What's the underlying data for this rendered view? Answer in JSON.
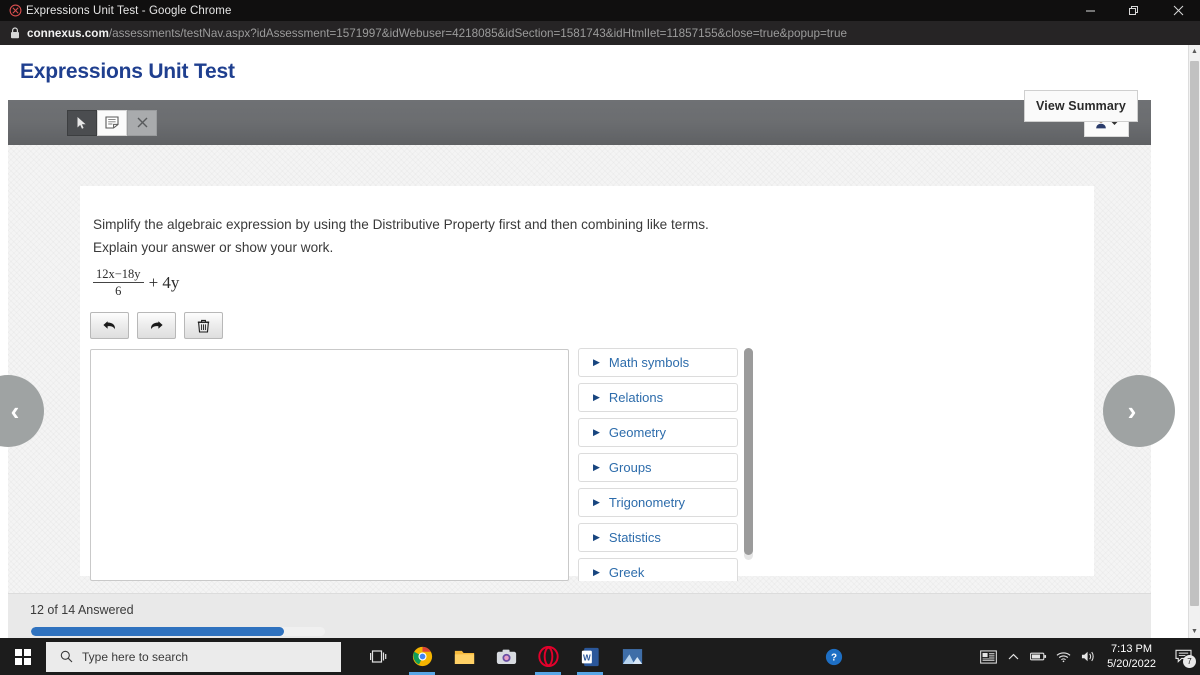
{
  "browser": {
    "window_title": "Expressions Unit Test - Google Chrome",
    "app_icon": "chrome-icon",
    "minimize_label": "–",
    "restore_label": "❐",
    "close_label": "✕",
    "url_host": "connexus.com",
    "url_path": "/assessments/testNav.aspx?idAssessment=1571997&idWebuser=4218085&idSection=1581743&idHtmlIet=11857155&close=true&popup=true",
    "lock_icon": "lock-icon"
  },
  "page": {
    "title": "Expressions Unit Test"
  },
  "toolbar": {
    "buttons": [
      {
        "name": "pointer-tool",
        "icon": "cursor-arrow-icon",
        "state": "selected"
      },
      {
        "name": "annotate-tool",
        "icon": "note-icon",
        "state": "normal"
      },
      {
        "name": "clear-tool",
        "icon": "close-x-icon",
        "state": "disabled"
      }
    ],
    "user_menu": {
      "icon": "user-icon",
      "caret": "▼"
    }
  },
  "question": {
    "prompt_line1": "Simplify the algebraic expression by using the Distributive Property first and then combining like terms.",
    "prompt_line2": "Explain your answer or show your work.",
    "expression": {
      "numerator": "12x−18y",
      "denominator": "6",
      "trailing": "+ 4y"
    },
    "edit_buttons": [
      {
        "name": "undo-button",
        "icon": "undo-arrow-icon",
        "label": "↶"
      },
      {
        "name": "redo-button",
        "icon": "redo-arrow-icon",
        "label": "↷"
      },
      {
        "name": "delete-button",
        "icon": "trash-icon",
        "label": "🗑"
      }
    ],
    "answer_value": "",
    "answer_placeholder": ""
  },
  "symbol_panel": {
    "items": [
      {
        "label": "Math symbols"
      },
      {
        "label": "Relations"
      },
      {
        "label": "Geometry"
      },
      {
        "label": "Groups"
      },
      {
        "label": "Trigonometry"
      },
      {
        "label": "Statistics"
      },
      {
        "label": "Greek"
      }
    ],
    "caret": "▶"
  },
  "navigation": {
    "prev_label": "‹",
    "next_label": "›"
  },
  "footer": {
    "answered_text": "12 of 14 Answered",
    "progress_percent": 86,
    "summary_label": "View Summary"
  },
  "scrollbar": {
    "up_arrow": "▲",
    "down_arrow": "▼"
  },
  "taskbar": {
    "start_icon": "windows-logo-icon",
    "search_placeholder": "Type here to search",
    "search_icon": "search-icon",
    "task_view_icon": "task-view-icon",
    "apps": [
      {
        "name": "chrome-taskbar-icon",
        "active": true
      },
      {
        "name": "file-explorer-taskbar-icon",
        "active": false
      },
      {
        "name": "camera-taskbar-icon",
        "active": false
      },
      {
        "name": "opera-taskbar-icon",
        "active": true
      },
      {
        "name": "word-taskbar-icon",
        "active": true
      },
      {
        "name": "photos-taskbar-icon",
        "active": false
      }
    ],
    "help_icon": "help-circle-icon",
    "tray": {
      "news_icon": "news-weather-icon",
      "chevron_up": "⌃",
      "battery_icon": "battery-icon",
      "wifi_icon": "wifi-icon",
      "volume_icon": "volume-icon",
      "time": "7:13 PM",
      "date": "5/20/2022",
      "notification_icon": "notification-icon",
      "notification_count": "7"
    }
  },
  "colors": {
    "title_blue": "#1f3f8f",
    "link_blue": "#2d6cab",
    "progress_blue": "#2f72bf",
    "toolbar_gray": "#6b6d70"
  }
}
